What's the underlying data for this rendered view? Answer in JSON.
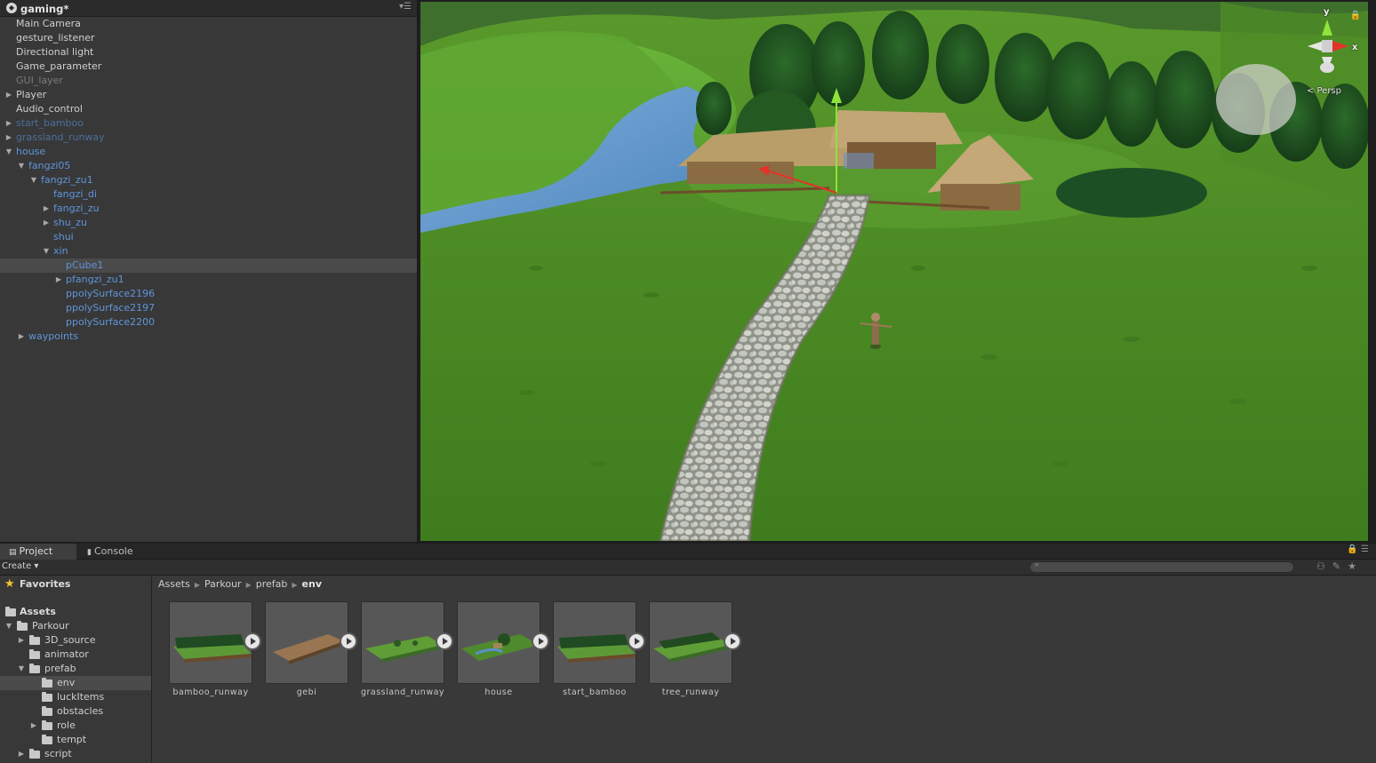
{
  "hierarchy": {
    "scene_title": "gaming*",
    "items": [
      {
        "label": "Main Camera"
      },
      {
        "label": "gesture_listener"
      },
      {
        "label": "Directional light"
      },
      {
        "label": "Game_parameter"
      },
      {
        "label": "GUI_layer"
      },
      {
        "label": "Player"
      },
      {
        "label": "Audio_control"
      },
      {
        "label": "start_bamboo"
      },
      {
        "label": "grassland_runway"
      },
      {
        "label": "house"
      },
      {
        "label": "fangzi05"
      },
      {
        "label": "fangzi_zu1"
      },
      {
        "label": "fangzi_di"
      },
      {
        "label": "fangzi_zu"
      },
      {
        "label": "shu_zu"
      },
      {
        "label": "shui"
      },
      {
        "label": "xin"
      },
      {
        "label": "pCube1"
      },
      {
        "label": "pfangzi_zu1"
      },
      {
        "label": "ppolySurface2196"
      },
      {
        "label": "ppolySurface2197"
      },
      {
        "label": "ppolySurface2200"
      },
      {
        "label": "waypoints"
      }
    ]
  },
  "scene": {
    "gizmo": {
      "y_label": "y",
      "x_label": "x",
      "projection_label": "< Persp"
    }
  },
  "project": {
    "tabs": [
      {
        "label": "Project"
      },
      {
        "label": "Console"
      }
    ],
    "create_label": "Create",
    "search": {
      "placeholder": ""
    },
    "folders": [
      {
        "label": "Favorites"
      },
      {
        "label": "Assets"
      },
      {
        "label": "Parkour"
      },
      {
        "label": "3D_source"
      },
      {
        "label": "animator"
      },
      {
        "label": "prefab"
      },
      {
        "label": "env"
      },
      {
        "label": "luckItems"
      },
      {
        "label": "obstacles"
      },
      {
        "label": "role"
      },
      {
        "label": "tempt"
      },
      {
        "label": "script"
      }
    ],
    "breadcrumb": [
      "Assets",
      "Parkour",
      "prefab",
      "env"
    ],
    "assets": [
      {
        "name": "bamboo_runway"
      },
      {
        "name": "gebi"
      },
      {
        "name": "grassland_runway"
      },
      {
        "name": "house"
      },
      {
        "name": "start_bamboo"
      },
      {
        "name": "tree_runway"
      }
    ]
  }
}
